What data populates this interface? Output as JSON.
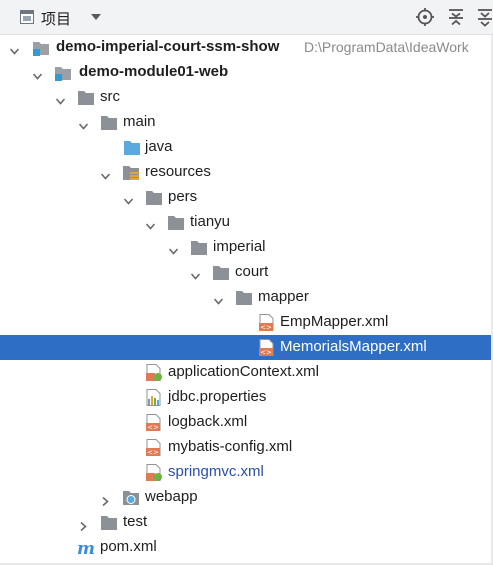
{
  "toolbar": {
    "title": "项目",
    "icons": [
      "project-icon",
      "dropdown-icon",
      "locate-icon",
      "collapse-all-icon",
      "expand-all-icon"
    ]
  },
  "tree": [
    {
      "label": "demo-imperial-court-ssm-show",
      "path": "D:\\ProgramData\\IdeaWork",
      "icon": "module-icon",
      "expanded": true,
      "bold": true
    },
    {
      "label": "demo-module01-web",
      "icon": "module-icon",
      "expanded": true,
      "bold": true
    },
    {
      "label": "src",
      "icon": "folder-icon",
      "expanded": true
    },
    {
      "label": "main",
      "icon": "folder-icon",
      "expanded": true
    },
    {
      "label": "java",
      "icon": "source-folder-icon"
    },
    {
      "label": "resources",
      "icon": "resources-folder-icon",
      "expanded": true
    },
    {
      "label": "pers",
      "icon": "folder-icon",
      "expanded": true
    },
    {
      "label": "tianyu",
      "icon": "folder-icon",
      "expanded": true
    },
    {
      "label": "imperial",
      "icon": "folder-icon",
      "expanded": true
    },
    {
      "label": "court",
      "icon": "folder-icon",
      "expanded": true
    },
    {
      "label": "mapper",
      "icon": "folder-icon",
      "expanded": true
    },
    {
      "label": "EmpMapper.xml",
      "icon": "xml-file-icon"
    },
    {
      "label": "MemorialsMapper.xml",
      "icon": "xml-file-icon",
      "selected": true
    },
    {
      "label": "applicationContext.xml",
      "icon": "spring-xml-icon"
    },
    {
      "label": "jdbc.properties",
      "icon": "properties-file-icon"
    },
    {
      "label": "logback.xml",
      "icon": "xml-file-icon"
    },
    {
      "label": "mybatis-config.xml",
      "icon": "xml-file-icon"
    },
    {
      "label": "springmvc.xml",
      "icon": "spring-xml-icon",
      "modified": true
    },
    {
      "label": "webapp",
      "icon": "web-folder-icon",
      "expanded": false
    },
    {
      "label": "test",
      "icon": "folder-icon",
      "expanded": false
    },
    {
      "label": "pom.xml",
      "icon": "maven-icon"
    }
  ],
  "colors": {
    "selection": "#2e6ec4",
    "folder": "#8c9198",
    "source_folder": "#5aa9df",
    "xml_file": "#e07a53",
    "spring_leaf": "#6cb33f",
    "maven": "#3c8bd4",
    "modified_text": "#2b4fa8"
  }
}
